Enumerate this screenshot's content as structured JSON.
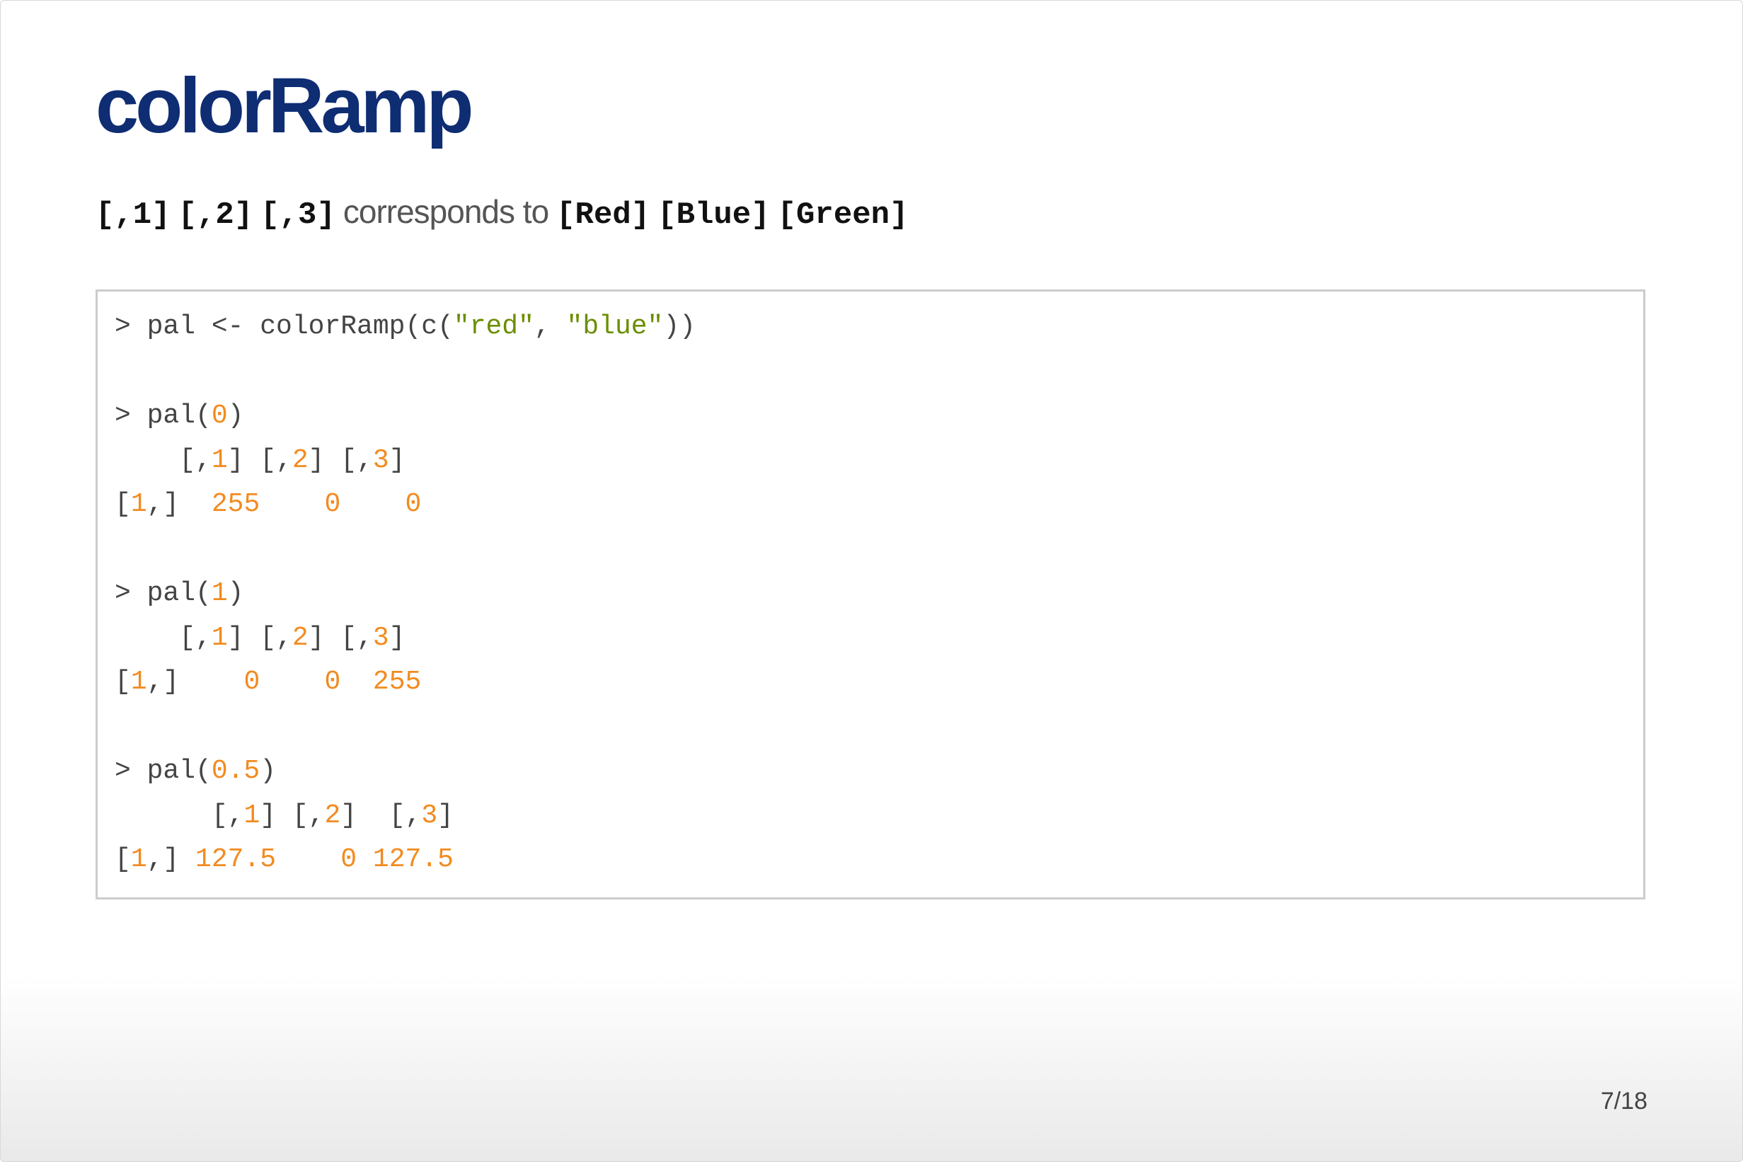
{
  "slide": {
    "title": "colorRamp",
    "page": "7/18"
  },
  "subtitle": {
    "cols": [
      "[,1]",
      "[,2]",
      "[,3]"
    ],
    "middle": "corresponds to",
    "colors": [
      "[Red]",
      "[Blue]",
      "[Green]"
    ]
  },
  "code": {
    "line1": {
      "a": "> pal <- colorRamp(c(",
      "s1": "\"red\"",
      "b": ", ",
      "s2": "\"blue\"",
      "c": "))"
    },
    "block0": {
      "call_a": "> pal(",
      "call_n": "0",
      "call_b": ")",
      "h1": "[,",
      "h1n": "1",
      "h2": "] [,",
      "h2n": "2",
      "h3": "] [,",
      "h3n": "3",
      "h4": "]",
      "r_a": "[",
      "r_n": "1",
      "r_b": ",]",
      "v1": "255",
      "v2": "0",
      "v3": "0"
    },
    "block1": {
      "call_a": "> pal(",
      "call_n": "1",
      "call_b": ")",
      "h1": "[,",
      "h1n": "1",
      "h2": "] [,",
      "h2n": "2",
      "h3": "] [,",
      "h3n": "3",
      "h4": "]",
      "r_a": "[",
      "r_n": "1",
      "r_b": ",]",
      "v1": "0",
      "v2": "0",
      "v3": "255"
    },
    "block2": {
      "call_a": "> pal(",
      "call_n": "0.5",
      "call_b": ")",
      "h1": "[,",
      "h1n": "1",
      "h2": "] [,",
      "h2n": "2",
      "h3": "]  [,",
      "h3n": "3",
      "h4": "]",
      "r_a": "[",
      "r_n": "1",
      "r_b": ",]",
      "v1": "127.5",
      "v2": "0",
      "v3": "127.5"
    }
  }
}
